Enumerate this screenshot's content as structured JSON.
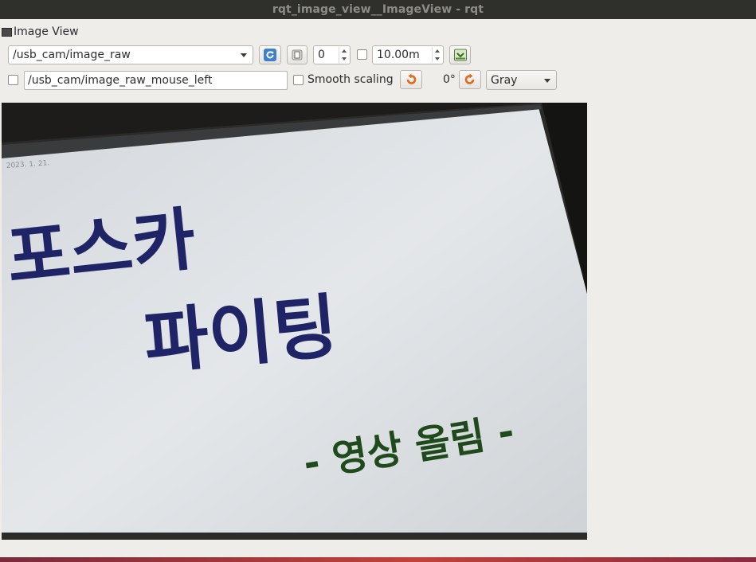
{
  "window": {
    "title": "rqt_image_view__ImageView - rqt"
  },
  "dock": {
    "title": "Image View"
  },
  "toolbar": {
    "topic": "/usb_cam/image_raw",
    "refresh_icon": "refresh-icon",
    "zoom_icon": "zoom-fit-icon",
    "zoom_value": "0",
    "dynamic_range_value": "10.00m",
    "save_icon": "save-image-icon"
  },
  "toolbar2": {
    "mouse_topic": "/usb_cam/image_raw_mouse_left",
    "smooth_scaling_label": "Smooth scaling",
    "rotate_left_icon": "rotate-left-icon",
    "rotation_value": "0°",
    "rotate_right_icon": "rotate-right-icon",
    "color_scheme": "Gray"
  },
  "image": {
    "handwritten_lines": [
      "포스카",
      "파이팅",
      "- 영상 올림 -"
    ],
    "date_text": "2023. 1. 21.",
    "ink_navy": "#1f2466",
    "ink_green": "#1f4a1c"
  }
}
